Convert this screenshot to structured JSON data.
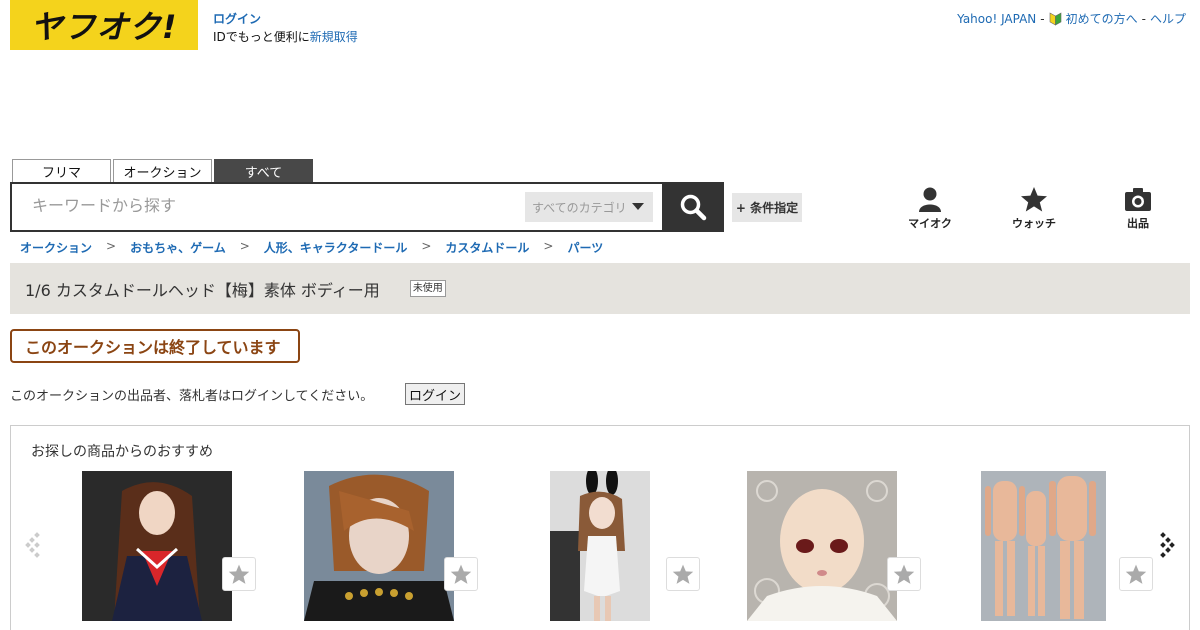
{
  "logo": {
    "text": "ヤフオク!"
  },
  "login": {
    "link": "ログイン",
    "sub_prefix": "IDでもっと便利に",
    "sub_link": "新規取得"
  },
  "top_links": {
    "yahoo": "Yahoo! JAPAN",
    "beginner": "初めての方へ",
    "help": "ヘルプ",
    "sep": "-"
  },
  "search": {
    "tabs": [
      {
        "label": "フリマ",
        "active": false
      },
      {
        "label": "オークション",
        "active": false
      },
      {
        "label": "すべて",
        "active": true
      }
    ],
    "placeholder": "キーワードから探す",
    "category": "すべてのカテゴリ",
    "condition": "+ 条件指定"
  },
  "nav": {
    "myauc": "マイオク",
    "watch": "ウォッチ",
    "sell": "出品"
  },
  "breadcrumb": [
    "オークション",
    "おもちゃ、ゲーム",
    "人形、キャラクタードール",
    "カスタムドール",
    "パーツ"
  ],
  "breadcrumb_sep": ">",
  "item": {
    "title": "1/6 カスタムドールヘッド【梅】素体 ボディー用",
    "condition_badge": "未使用"
  },
  "status": {
    "ended": "このオークションは終了しています",
    "login_message": "このオークションの出品者、落札者はログインしてください。",
    "login_button": "ログイン"
  },
  "recommendations": {
    "title": "お探しの商品からのおすすめ",
    "items": [
      {
        "image": "doll-in-sailor-uniform"
      },
      {
        "image": "doll-with-brown-hair"
      },
      {
        "image": "doll-in-bunny-costume"
      },
      {
        "image": "doll-head-on-lace"
      },
      {
        "image": "doll-bodies"
      }
    ]
  },
  "colors": {
    "brand": "#f4d31c",
    "link": "#1e6ab3",
    "ended": "#8b4513",
    "title_bg": "#e5e3de"
  }
}
